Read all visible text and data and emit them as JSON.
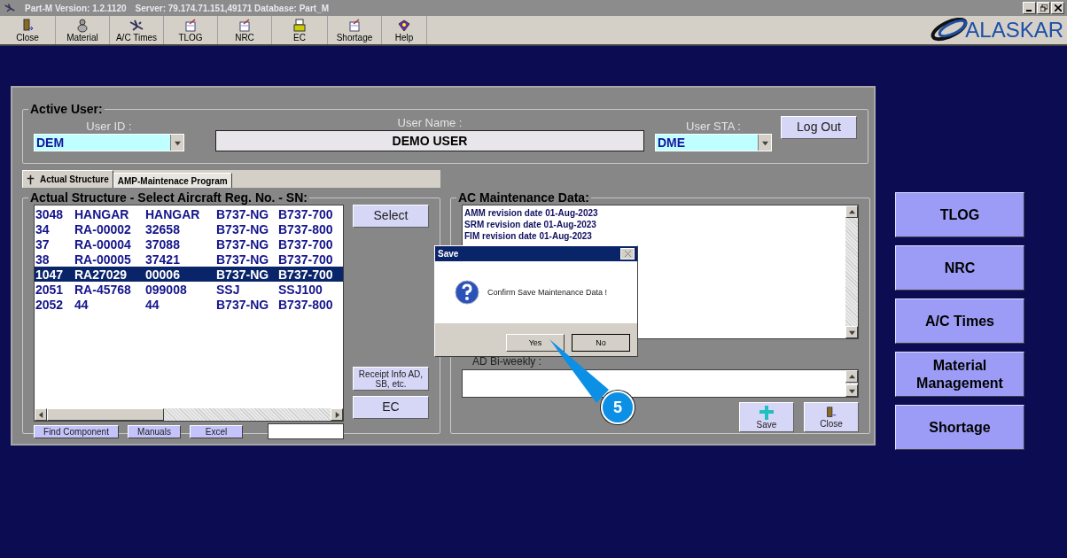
{
  "window": {
    "title": "Part-M  Version: 1.2.1120",
    "server_info": "Server: 79.174.71.151,49171 Database: Part_M"
  },
  "toolbar": [
    "Close",
    "Material",
    "A/C Times",
    "TLOG",
    "NRC",
    "EC",
    "Shortage",
    "Help"
  ],
  "logo": "ALASKAR",
  "active_user": {
    "legend": "Active User:",
    "user_id_label": "User ID :",
    "user_id": "DEM",
    "user_name_label": "User Name :",
    "user_name": "DEMO USER",
    "user_sta_label": "User STA :",
    "user_sta": "DME",
    "logout": "Log Out"
  },
  "tabs": [
    {
      "label": "Actual Structure",
      "selected": true
    },
    {
      "label": "AMP-Maintenace Program",
      "selected": false
    }
  ],
  "structure": {
    "legend": "Actual Structure - Select Aircraft Reg. No. - SN:",
    "rows": [
      {
        "cells": [
          "3048",
          "HANGAR",
          "HANGAR",
          "B737-NG",
          "B737-700"
        ],
        "selected": false
      },
      {
        "cells": [
          "34",
          "RA-00002",
          "32658",
          "B737-NG",
          "B737-800"
        ],
        "selected": false
      },
      {
        "cells": [
          "37",
          "RA-00004",
          "37088",
          "B737-NG",
          "B737-700"
        ],
        "selected": false
      },
      {
        "cells": [
          "38",
          "RA-00005",
          "37421",
          "B737-NG",
          "B737-700"
        ],
        "selected": false
      },
      {
        "cells": [
          "1047",
          "RA27029",
          "00006",
          "B737-NG",
          "B737-700"
        ],
        "selected": true
      },
      {
        "cells": [
          "2051",
          "RA-45768",
          "099008",
          "SSJ",
          "SSJ100"
        ],
        "selected": false
      },
      {
        "cells": [
          "2052",
          "44",
          "44",
          "B737-NG",
          "B737-800"
        ],
        "selected": false
      }
    ],
    "select_button": "Select",
    "receipt_button": "Receipt Info AD, SB, etc.",
    "ec_button": "EC",
    "bottom_buttons": [
      "Find Component",
      "Manuals",
      "Excel"
    ]
  },
  "maintenance": {
    "legend": "AC Maintenance Data:",
    "lines": [
      "AMM revision date 01-Aug-2023",
      "SRM revision date 01-Aug-2023",
      "FIM revision date 01-Aug-2023"
    ],
    "ad_label": "AD Bi-weekly :",
    "buttons": [
      "Save",
      "Close"
    ]
  },
  "dialog": {
    "title": "Save",
    "message": "Confirm Save Maintenance Data !",
    "buttons": [
      "Yes",
      "No"
    ]
  },
  "callout": {
    "number": "5"
  },
  "side_buttons": [
    "TLOG",
    "NRC",
    "A/C Times",
    "Material Management",
    "Shortage"
  ]
}
